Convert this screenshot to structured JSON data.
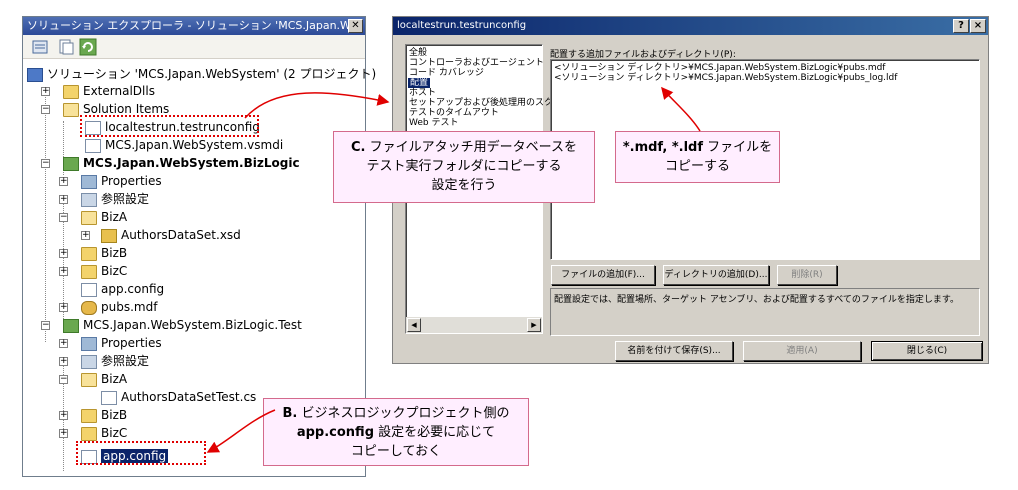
{
  "solution_explorer": {
    "title": "ソリューション エクスプローラ - ソリューション 'MCS.Japan.W...",
    "close": "✕",
    "toolbar": [
      {
        "icon": "properties-icon"
      },
      {
        "icon": "show-all-files-icon"
      },
      {
        "icon": "refresh-icon"
      }
    ],
    "tree": {
      "solution": "ソリューション 'MCS.Japan.WebSystem' (2 プロジェクト)",
      "external": "ExternalDlls",
      "solution_items": "Solution Items",
      "testrunconfig": "localtestrun.testrunconfig",
      "vsmdi": "MCS.Japan.WebSystem.vsmdi",
      "bizlogic": "MCS.Japan.WebSystem.BizLogic",
      "properties1": "Properties",
      "refs1": "参照設定",
      "biza1": "BizA",
      "authorsdataset": "AuthorsDataSet.xsd",
      "bizb1": "BizB",
      "bizc1": "BizC",
      "appconfig1": "app.config",
      "pubsmdf": "pubs.mdf",
      "test": "MCS.Japan.WebSystem.BizLogic.Test",
      "properties2": "Properties",
      "refs2": "参照設定",
      "biza2": "BizA",
      "authorstest": "AuthorsDataSetTest.cs",
      "bizb2": "BizB",
      "bizc2": "BizC",
      "appconfig2": "app.config"
    }
  },
  "dialog": {
    "title": "localtestrun.testrunconfig",
    "help": "?",
    "close": "×",
    "categories": [
      "全般",
      "コントローラおよびエージェント",
      "コード カバレッジ",
      "配置",
      "ホスト",
      "セットアップおよび後処理用のスクリプト",
      "テストのタイムアウト",
      "Web テスト"
    ],
    "selected_category": "配置",
    "files_label": "配置する追加ファイルおよびディレクトリ(P):",
    "files": [
      "<ソリューション ディレクトリ>¥MCS.Japan.WebSystem.BizLogic¥pubs.mdf",
      "<ソリューション ディレクトリ>¥MCS.Japan.WebSystem.BizLogic¥pubs_log.ldf"
    ],
    "add_file": "ファイルの追加(F)...",
    "add_dir": "ディレクトリの追加(D)...",
    "delete": "削除(R)",
    "description": "配置設定では、配置場所、ターゲット アセンブリ、および配置するすべてのファイルを指定します。",
    "save_as": "名前を付けて保存(S)...",
    "apply": "適用(A)",
    "close_btn": "閉じる(C)"
  },
  "callouts": {
    "c_line1_bold": "C.",
    "c_line1": " ファイルアタッチ用データベースを",
    "c_line2": "テスト実行フォルダにコピーする",
    "c_line3": "設定を行う",
    "mdf_line1_bold": "*.mdf, *.ldf",
    "mdf_line1": " ファイルを",
    "mdf_line2": "コピーする",
    "b_line1_bold": "B.",
    "b_line1": " ビジネスロジックプロジェクト側の",
    "b_line2_bold": "app.config",
    "b_line2": " 設定を必要に応じて",
    "b_line3": "コピーしておく"
  },
  "colors": {
    "callout_bg": "#ffeeff",
    "callout_border": "#d46a8c",
    "arrow": "#e00000",
    "selection": "#0a246a"
  }
}
